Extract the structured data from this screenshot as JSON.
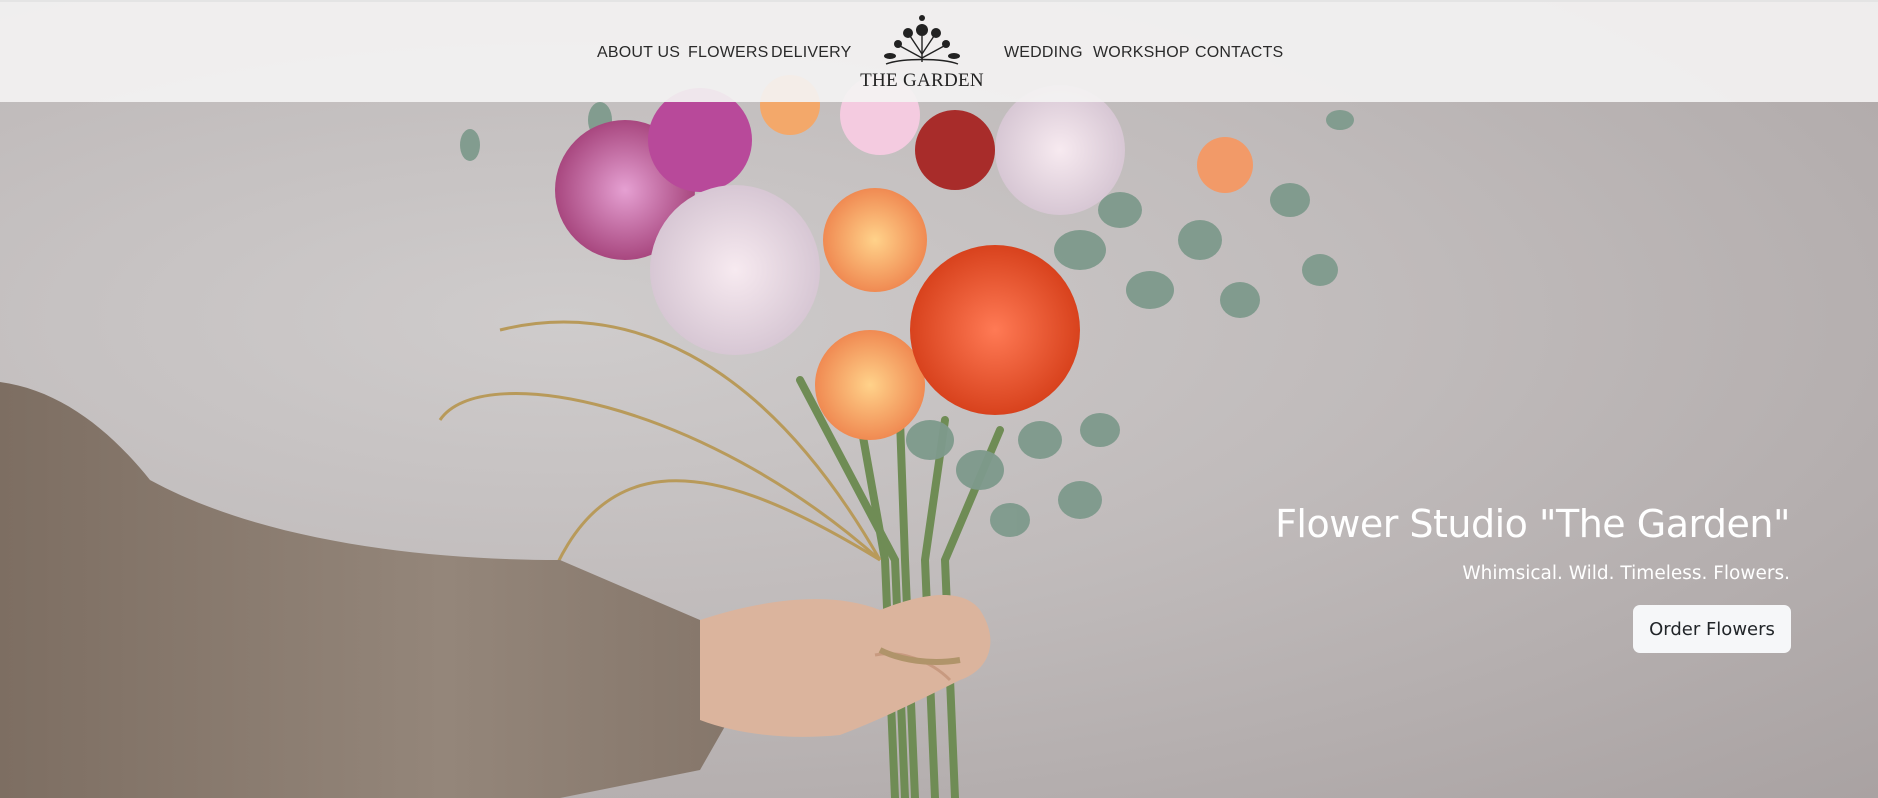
{
  "nav": {
    "left_links": [
      "ABOUT US",
      "FLOWERS",
      "DELIVERY"
    ],
    "right_links": [
      "WEDDING",
      "WORKSHOP",
      "CONTACTS"
    ],
    "brand_name": "THE GARDEN",
    "brand_icon": "floral-bouquet-logo-icon"
  },
  "hero": {
    "title": "Flower Studio \"The Garden\"",
    "subtitle": "Whimsical. Wild. Timeless. Flowers.",
    "cta_label": "Order Flowers",
    "image": "bouquet-held-in-hand-photo"
  },
  "colors": {
    "nav_background": "#f3f2f2",
    "button_background": "#f6f7f9",
    "hero_text": "#ffffff"
  }
}
